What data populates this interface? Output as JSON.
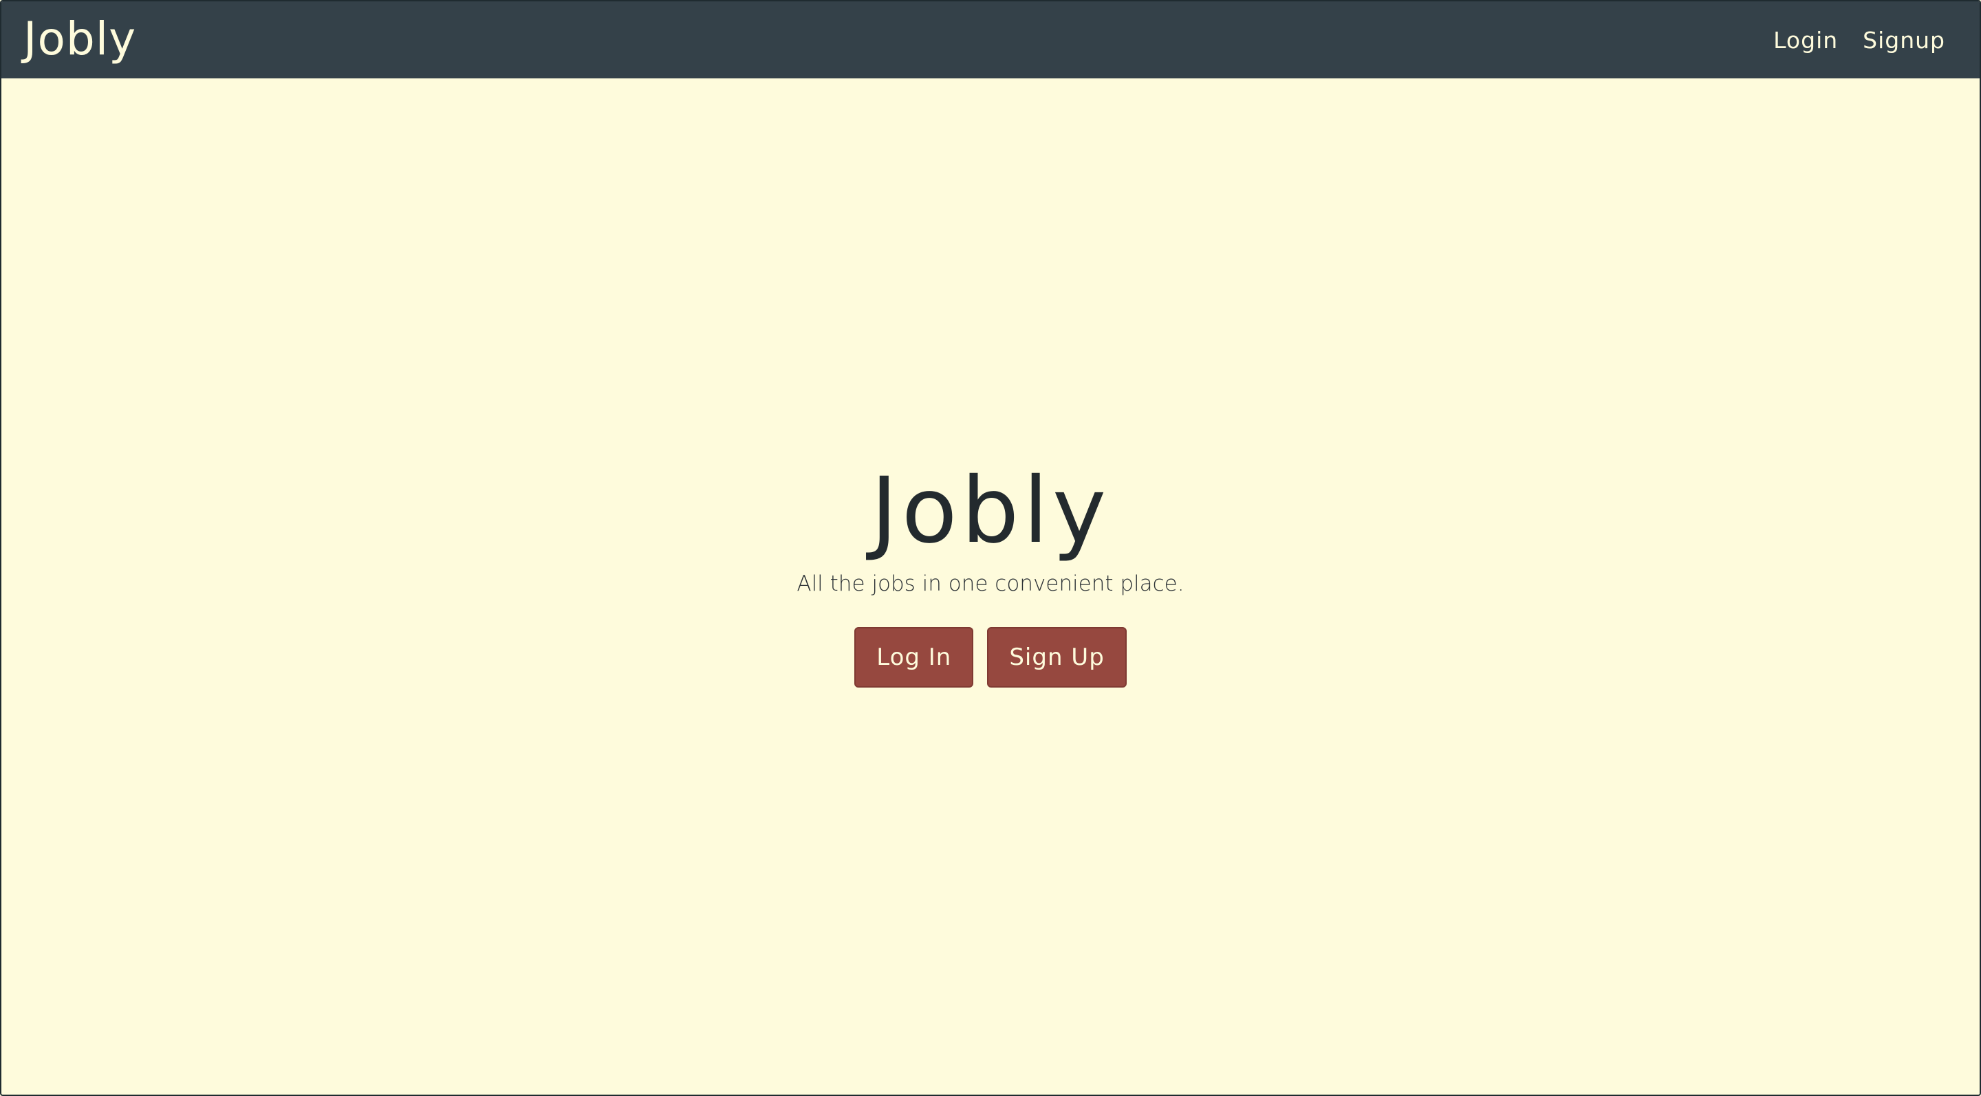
{
  "navbar": {
    "brand": "Jobly",
    "links": [
      {
        "label": "Login"
      },
      {
        "label": "Signup"
      }
    ]
  },
  "hero": {
    "title": "Jobly",
    "subtitle": "All the jobs in one convenient place.",
    "buttons": [
      {
        "label": "Log In"
      },
      {
        "label": "Sign Up"
      }
    ]
  },
  "colors": {
    "navbar_bg": "#344149",
    "page_bg": "#fefbdc",
    "button_bg": "#96483f",
    "title_text": "#232a2e"
  }
}
